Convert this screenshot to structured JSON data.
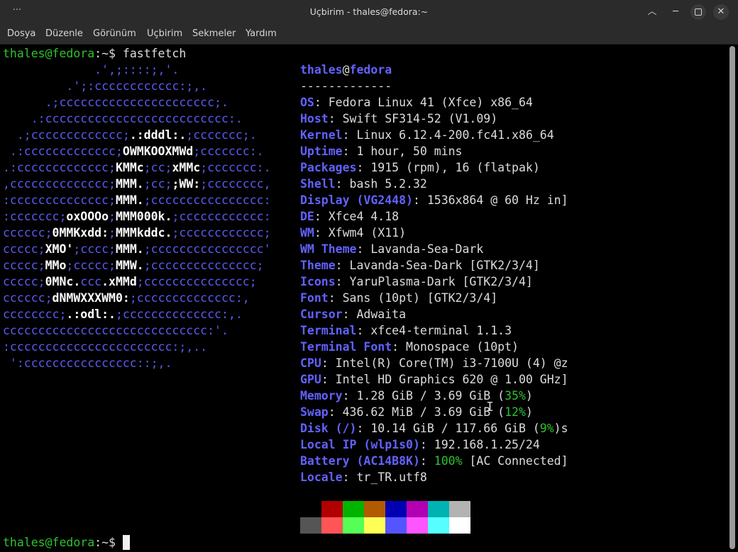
{
  "window": {
    "title": "Uçbirim - thales@fedora:~",
    "menu_glyph": "···",
    "controls": {
      "up_glyph": "︿",
      "min_glyph": "─",
      "close_glyph": "✕"
    }
  },
  "menubar": {
    "items": [
      {
        "label": "Dosya"
      },
      {
        "label": "Düzenle"
      },
      {
        "label": "Görünüm"
      },
      {
        "label": "Uçbirim"
      },
      {
        "label": "Sekmeler"
      },
      {
        "label": "Yardım"
      }
    ]
  },
  "terminal": {
    "prompt": {
      "user": "thales@fedora",
      "suffix": ":~$ "
    },
    "command": "fastfetch",
    "user_at_host": {
      "user": "thales",
      "at": "@",
      "host": "fedora"
    },
    "separator": "-------------",
    "info": [
      {
        "key": "OS",
        "value": ": Fedora Linux 41 (Xfce) x86_64"
      },
      {
        "key": "Host",
        "value": ": Swift SF314-52 (V1.09)"
      },
      {
        "key": "Kernel",
        "value": ": Linux 6.12.4-200.fc41.x86_64"
      },
      {
        "key": "Uptime",
        "value": ": 1 hour, 50 mins"
      },
      {
        "key": "Packages",
        "value": ": 1915 (rpm), 16 (flatpak)"
      },
      {
        "key": "Shell",
        "value": ": bash 5.2.32"
      },
      {
        "key": "Display (VG2448)",
        "value": ": 1536x864 @ 60 Hz in]"
      },
      {
        "key": "DE",
        "value": ": Xfce4 4.18"
      },
      {
        "key": "WM",
        "value": ": Xfwm4 (X11)"
      },
      {
        "key": "WM Theme",
        "value": ": Lavanda-Sea-Dark"
      },
      {
        "key": "Theme",
        "value": ": Lavanda-Sea-Dark [GTK2/3/4]"
      },
      {
        "key": "Icons",
        "value": ": YaruPlasma-Dark [GTK2/3/4]"
      },
      {
        "key": "Font",
        "value": ": Sans (10pt) [GTK2/3/4]"
      },
      {
        "key": "Cursor",
        "value": ": Adwaita"
      },
      {
        "key": "Terminal",
        "value": ": xfce4-terminal 1.1.3"
      },
      {
        "key": "Terminal Font",
        "value": ": Monospace (10pt)"
      },
      {
        "key": "CPU",
        "value": ": Intel(R) Core(TM) i3-7100U (4) @z"
      },
      {
        "key": "GPU",
        "value": ": Intel HD Graphics 620 @ 1.00 GHz]"
      },
      {
        "key": "Memory",
        "value": ": 1.28 GiB / 3.69 GiB (",
        "pct": "35%",
        "tail": ")"
      },
      {
        "key": "Swap",
        "value": ": 436.62 MiB / 3.69 GiB (",
        "pct": "12%",
        "tail": ")"
      },
      {
        "key": "Disk (/)",
        "value": ": 10.14 GiB / 117.66 GiB (",
        "pct": "9%",
        "tail": ")s"
      },
      {
        "key": "Local IP (wlp1s0)",
        "value": ": 192.168.1.25/24"
      },
      {
        "key": "Battery (AC14B8K)",
        "value": ": ",
        "pct": "100%",
        "tail": " [AC Connected]"
      },
      {
        "key": "Locale",
        "value": ": tr_TR.utf8"
      }
    ],
    "logo_lines": [
      [
        {
          "t": "             .',;::::;,'."
        }
      ],
      [
        {
          "t": "         .';:cccccccccccc:;,."
        }
      ],
      [
        {
          "t": "      .;cccccccccccccccccccccc;."
        }
      ],
      [
        {
          "t": "    .:cccccccccccccccccccccccccc:."
        }
      ],
      [
        {
          "t": "  .;ccccccccccccc;"
        },
        {
          "t": ".:dddl:.",
          "b": 1
        },
        {
          "t": ";ccccccc;."
        }
      ],
      [
        {
          "t": " .:ccccccccccccc;"
        },
        {
          "t": "OWMKOOXMWd",
          "b": 1
        },
        {
          "t": ";ccccccc:."
        }
      ],
      [
        {
          "t": ".:ccccccccccccc;"
        },
        {
          "t": "KMMc",
          "b": 1
        },
        {
          "t": ";cc;"
        },
        {
          "t": "xMMc",
          "b": 1
        },
        {
          "t": ";ccccccc:."
        }
      ],
      [
        {
          "t": ",cccccccccccccc;"
        },
        {
          "t": "MMM.",
          "b": 1
        },
        {
          "t": ";cc;"
        },
        {
          "t": ";WW:",
          "b": 1
        },
        {
          "t": ";cccccccc,"
        }
      ],
      [
        {
          "t": ":cccccccccccccc;"
        },
        {
          "t": "MMM.",
          "b": 1
        },
        {
          "t": ";cccccccccccccccc:"
        }
      ],
      [
        {
          "t": ":ccccccc;"
        },
        {
          "t": "oxOOOo",
          "b": 1
        },
        {
          "t": ";"
        },
        {
          "t": "MMM000k.",
          "b": 1
        },
        {
          "t": ";cccccccccccc:"
        }
      ],
      [
        {
          "t": "cccccc;"
        },
        {
          "t": "0MMKxdd:",
          "b": 1
        },
        {
          "t": ";"
        },
        {
          "t": "MMMkddc.",
          "b": 1
        },
        {
          "t": ";cccccccccccc;"
        }
      ],
      [
        {
          "t": "ccccc;"
        },
        {
          "t": "XMO'",
          "b": 1
        },
        {
          "t": ";cccc;"
        },
        {
          "t": "MMM.",
          "b": 1
        },
        {
          "t": ";cccccccccccccccc'"
        }
      ],
      [
        {
          "t": "ccccc;"
        },
        {
          "t": "MMo",
          "b": 1
        },
        {
          "t": ";ccccc;"
        },
        {
          "t": "MMW.",
          "b": 1
        },
        {
          "t": ";ccccccccccccccc;"
        }
      ],
      [
        {
          "t": "ccccc;"
        },
        {
          "t": "0MNc.",
          "b": 1
        },
        {
          "t": "ccc"
        },
        {
          "t": ".xMMd",
          "b": 1
        },
        {
          "t": ";ccccccccccccccc;"
        }
      ],
      [
        {
          "t": "cccccc;"
        },
        {
          "t": "dNMWXXXWM0:",
          "b": 1
        },
        {
          "t": ";cccccccccccccc:,"
        }
      ],
      [
        {
          "t": "cccccccc;"
        },
        {
          "t": ".:odl:.",
          "b": 1
        },
        {
          "t": ";cccccccccccccc:,."
        }
      ],
      [
        {
          "t": "ccccccccccccccccccccccccccccc:'."
        }
      ],
      [
        {
          "t": ":ccccccccccccccccccccccc:;,.."
        }
      ],
      [
        {
          "t": " ':cccccccccccccccc::;,."
        }
      ]
    ],
    "palette_top": [
      "#000000",
      "#b10000",
      "#00b300",
      "#b25a00",
      "#0000b3",
      "#b300b3",
      "#00b3b3",
      "#b3b3b3"
    ],
    "palette_bottom": [
      "#555555",
      "#ff5555",
      "#55ff55",
      "#ffff55",
      "#5555ff",
      "#ff55ff",
      "#55ffff",
      "#ffffff"
    ]
  }
}
